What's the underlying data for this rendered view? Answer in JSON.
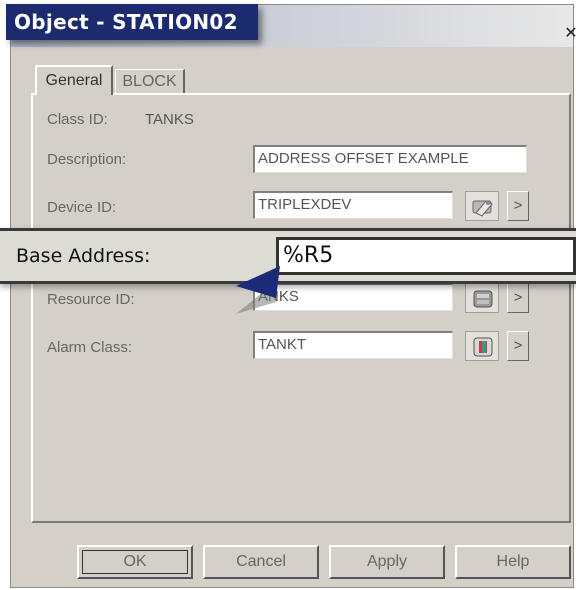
{
  "window": {
    "title": "Object - STATION02",
    "close_glyph": "✕"
  },
  "tabs": [
    {
      "label": "General",
      "active": true
    },
    {
      "label": "BLOCK",
      "active": false
    }
  ],
  "general": {
    "class_id_label": "Class ID:",
    "class_id_value": "TANKS",
    "description_label": "Description:",
    "description_value": "ADDRESS OFFSET EXAMPLE",
    "device_id_label": "Device ID:",
    "device_id_value": "TRIPLEXDEV",
    "resource_id_label": "Resource ID:",
    "resource_id_value": "ANKS",
    "alarm_class_label": "Alarm Class:",
    "alarm_class_value": "TANKT",
    "browse_arrow": ">"
  },
  "callout": {
    "base_address_label": "Base Address:",
    "base_address_value": "%R5"
  },
  "buttons": {
    "ok": "OK",
    "cancel": "Cancel",
    "apply": "Apply",
    "help": "Help"
  },
  "icons": {
    "device_browse": "device-browse-icon",
    "resource_browse": "resource-browse-icon",
    "alarm_browse": "alarm-class-icon",
    "pointer": "pointer-arrow-icon"
  },
  "colors": {
    "title_callout_bg": "#1c2a6e",
    "dialog_bg": "#d4d0c8",
    "pointer": "#1c2a78"
  }
}
